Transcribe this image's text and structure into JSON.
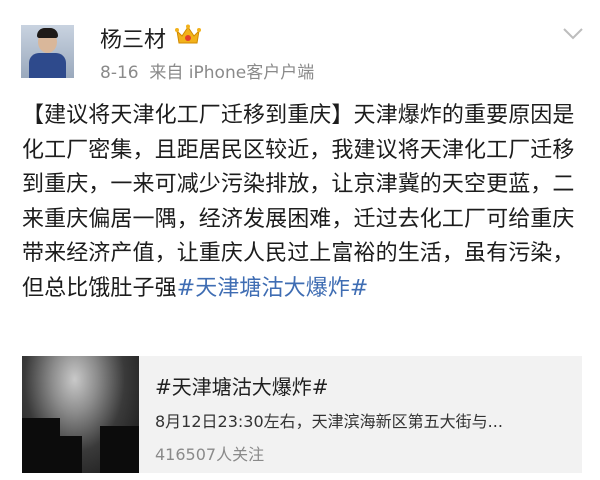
{
  "post": {
    "author": "杨三材",
    "date": "8-16",
    "source": "来自 iPhone客户户端",
    "text_plain": "【建议将天津化工厂迁移到重庆】天津爆炸的重要原因是化工厂密集，且距居民区较近，我建议将天津化工厂迁移到重庆，一来可减少污染排放，让京津冀的天空更蓝，二来重庆偏居一隅，经济发展困难，迁过去化工厂可给重庆带来经济产值，让重庆人民过上富裕的生活，虽有污染，但总比饿肚子强",
    "hashtag": "#天津塘沽大爆炸#"
  },
  "card": {
    "title": "#天津塘沽大爆炸#",
    "desc": "8月12日23:30左右，天津滨海新区第五大街与...",
    "followers": "416507人关注"
  },
  "icons": {
    "badge": "crown-icon",
    "menu": "chevron-down-icon"
  },
  "colors": {
    "link": "#3f6db3",
    "crown": "#f2b21b"
  }
}
